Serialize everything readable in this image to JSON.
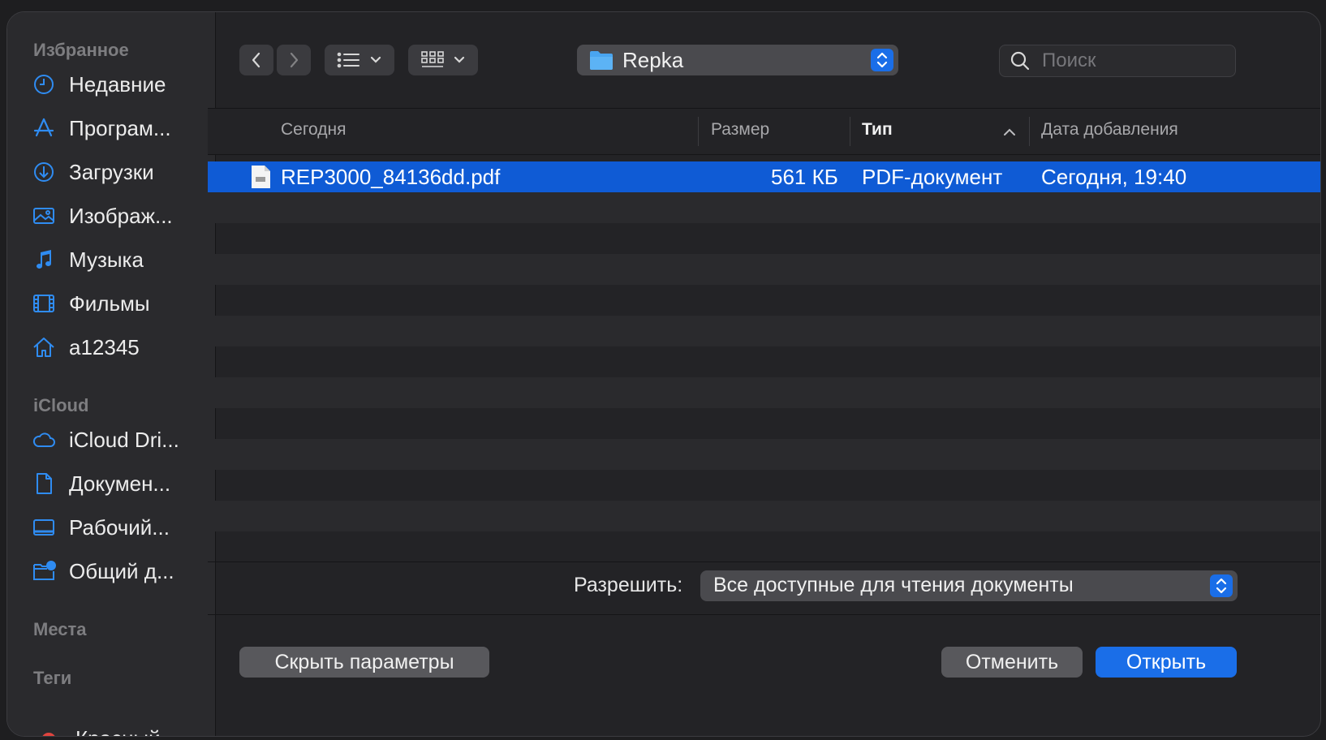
{
  "sidebar": {
    "favorites_header": "Избранное",
    "favorites": [
      {
        "label": "Недавние",
        "icon": "clock-icon"
      },
      {
        "label": "Програм...",
        "icon": "applications-icon"
      },
      {
        "label": "Загрузки",
        "icon": "download-icon"
      },
      {
        "label": "Изображ...",
        "icon": "photo-icon"
      },
      {
        "label": "Музыка",
        "icon": "music-note-icon"
      },
      {
        "label": "Фильмы",
        "icon": "film-icon"
      },
      {
        "label": "a12345",
        "icon": "home-icon"
      }
    ],
    "icloud_header": "iCloud",
    "icloud": [
      {
        "label": "iCloud Dri...",
        "icon": "cloud-icon"
      },
      {
        "label": "Докумен...",
        "icon": "document-icon"
      },
      {
        "label": "Рабочий...",
        "icon": "desktop-icon"
      },
      {
        "label": "Общий д...",
        "icon": "shared-folder-icon"
      }
    ],
    "places_header": "Места",
    "tags_header": "Теги",
    "clipped_tag": "Красный"
  },
  "toolbar": {
    "current_folder": "Repka",
    "search_placeholder": "Поиск"
  },
  "list": {
    "columns": [
      "Сегодня",
      "Размер",
      "Тип",
      "Дата добавления"
    ],
    "sorted_column": "Тип",
    "files": [
      {
        "name": "REP3000_84136dd.pdf",
        "size": "561 КБ",
        "kind": "PDF-документ",
        "added": "Сегодня, 19:40",
        "selected": true
      }
    ]
  },
  "bottom": {
    "allow_label": "Разрешить:",
    "filter_value": "Все доступные для чтения документы",
    "hide_options_label": "Скрыть параметры",
    "cancel_label": "Отменить",
    "open_label": "Открыть"
  },
  "colors": {
    "accent": "#1a6ee8",
    "selection": "#0f5bd5",
    "sidebar_icon": "#2f8cf2"
  }
}
